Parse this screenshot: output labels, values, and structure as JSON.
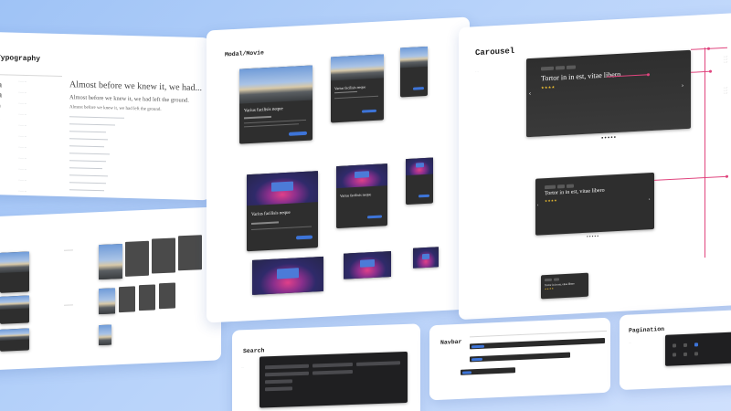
{
  "typography": {
    "title": "Typography",
    "samples": [
      "Almost before we knew it, we had...",
      "Almost before we knew it, we had left the ground.",
      "Almost before we knew it, we had left the ground."
    ]
  },
  "modal_movie": {
    "title": "Modal/Movie",
    "card_title": "Varius facilisis neque"
  },
  "carousel": {
    "title": "Carousel",
    "headline": "Tortor in in est, vitae libero",
    "prev_icon": "chevron-left",
    "next_icon": "chevron-right"
  },
  "search": {
    "title": "Search"
  },
  "navbar": {
    "title": "Navbar"
  },
  "pagination": {
    "title": "Pagination"
  },
  "colors": {
    "background": "#b8d3fa",
    "accent": "#3d74d8",
    "annotation": "#e0457e",
    "star": "#f1c232"
  }
}
